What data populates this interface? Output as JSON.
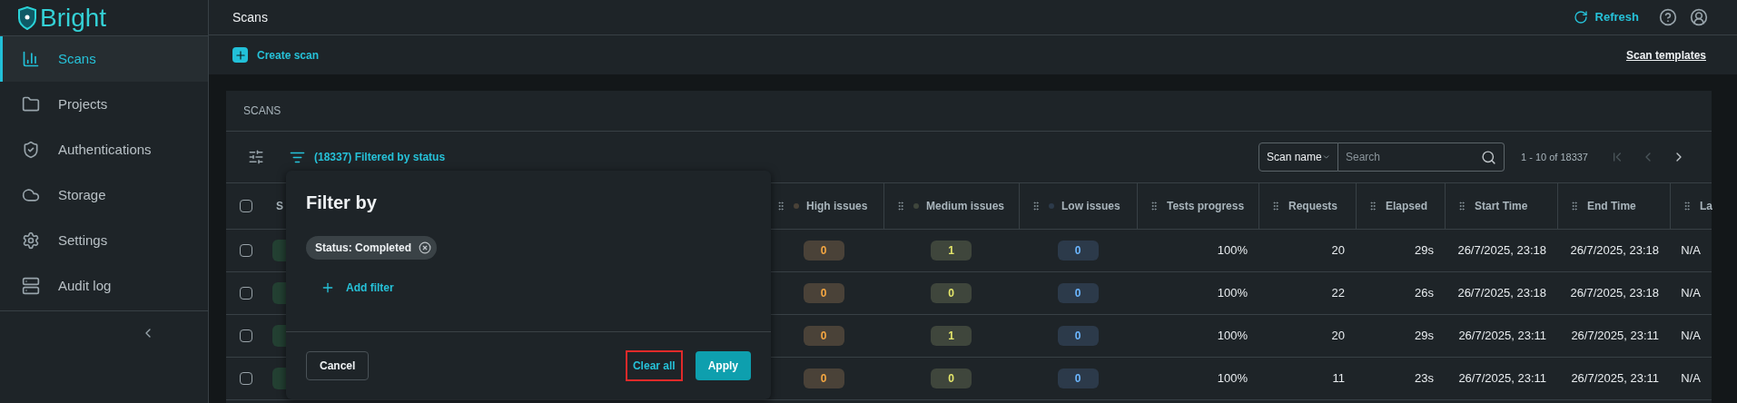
{
  "sidebar": {
    "logo": "Bright",
    "items": [
      {
        "label": "Scans",
        "selected": true
      },
      {
        "label": "Projects",
        "selected": false
      },
      {
        "label": "Authentications",
        "selected": false
      },
      {
        "label": "Storage",
        "selected": false
      },
      {
        "label": "Settings",
        "selected": false
      },
      {
        "label": "Audit log",
        "selected": false
      }
    ]
  },
  "header": {
    "title": "Scans",
    "refresh": "Refresh"
  },
  "action_bar": {
    "create": "Create scan",
    "templates": "Scan templates"
  },
  "card": {
    "title": "SCANS",
    "filter_summary": "(18337) Filtered by status",
    "search_by": "Scan name",
    "search": {
      "placeholder": "Search"
    },
    "pagination": "1 - 10 of 18337"
  },
  "table": {
    "select_all_checked": false,
    "columns": [
      {
        "label": "S",
        "kind": "plain"
      },
      {
        "label": "High issues",
        "kind": "severity",
        "color": "#4a4238"
      },
      {
        "label": "Medium issues",
        "kind": "severity",
        "color": "#3f463c"
      },
      {
        "label": "Low issues",
        "kind": "severity",
        "color": "#2c3a4a"
      },
      {
        "label": "Tests progress",
        "kind": "text"
      },
      {
        "label": "Requests",
        "kind": "text"
      },
      {
        "label": "Elapsed",
        "kind": "text"
      },
      {
        "label": "Start Time",
        "kind": "text"
      },
      {
        "label": "End Time",
        "kind": "text"
      },
      {
        "label": "La",
        "kind": "text"
      }
    ],
    "rows": [
      {
        "checked": false,
        "cells": [
          "",
          "0",
          "1",
          "0",
          "100%",
          "20",
          "29s",
          "26/7/2025, 23:18",
          "26/7/2025, 23:18",
          "N/A"
        ]
      },
      {
        "checked": false,
        "cells": [
          "",
          "0",
          "0",
          "0",
          "100%",
          "22",
          "26s",
          "26/7/2025, 23:18",
          "26/7/2025, 23:18",
          "N/A"
        ]
      },
      {
        "checked": false,
        "cells": [
          "",
          "0",
          "1",
          "0",
          "100%",
          "20",
          "29s",
          "26/7/2025, 23:11",
          "26/7/2025, 23:11",
          "N/A"
        ]
      },
      {
        "checked": false,
        "cells": [
          "",
          "0",
          "0",
          "0",
          "100%",
          "11",
          "23s",
          "26/7/2025, 23:11",
          "26/7/2025, 23:11",
          "N/A"
        ]
      }
    ]
  },
  "filter_popup": {
    "title": "Filter by",
    "chips": [
      {
        "label": "Status: Completed"
      }
    ],
    "add": "Add filter",
    "cancel": "Cancel",
    "clear_all": {
      "label": "Clear all",
      "highlighted": true
    },
    "apply": "Apply"
  }
}
